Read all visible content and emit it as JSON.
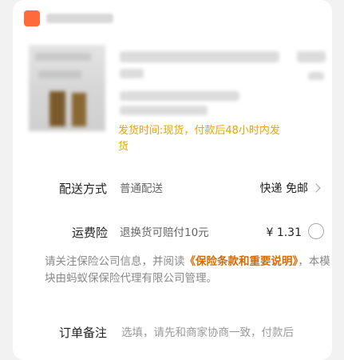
{
  "order": {
    "shipping_note": "发货时间:现货，付款后48小时内发货"
  },
  "delivery": {
    "label": "配送方式",
    "method": "普通配送",
    "value": "快递 免邮"
  },
  "insurance": {
    "label": "运费险",
    "description": "退换货可赔付10元",
    "price": "¥ 1.31",
    "selected": false
  },
  "notice": {
    "prefix": "请关注保险公司信息，并阅读",
    "link_text": "《保险条款和重要说明》",
    "suffix": "，本模块由蚂蚁保保险代理有限公司管理。"
  },
  "remark": {
    "label": "订单备注",
    "placeholder": "选填，请先和商家协商一致，付款后"
  },
  "colors": {
    "accent": "#ff6a3d",
    "shipping_note": "#e8a400",
    "link": "#d76a00"
  }
}
